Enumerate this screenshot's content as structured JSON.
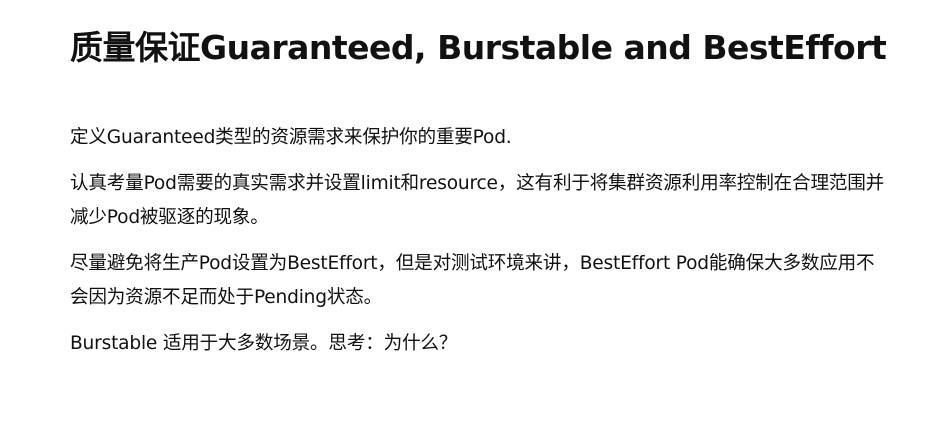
{
  "title": "质量保证Guaranteed, Burstable and BestEffort",
  "paragraphs": [
    "定义Guaranteed类型的资源需求来保护你的重要Pod.",
    "认真考量Pod需要的真实需求并设置limit和resource，这有利于将集群资源利用率控制在合理范围并减少Pod被驱逐的现象。",
    "尽量避免将生产Pod设置为BestEffort，但是对测试环境来讲，BestEffort Pod能确保大多数应用不会因为资源不足而处于Pending状态。",
    "Burstable 适用于大多数场景。思考：为什么？"
  ]
}
